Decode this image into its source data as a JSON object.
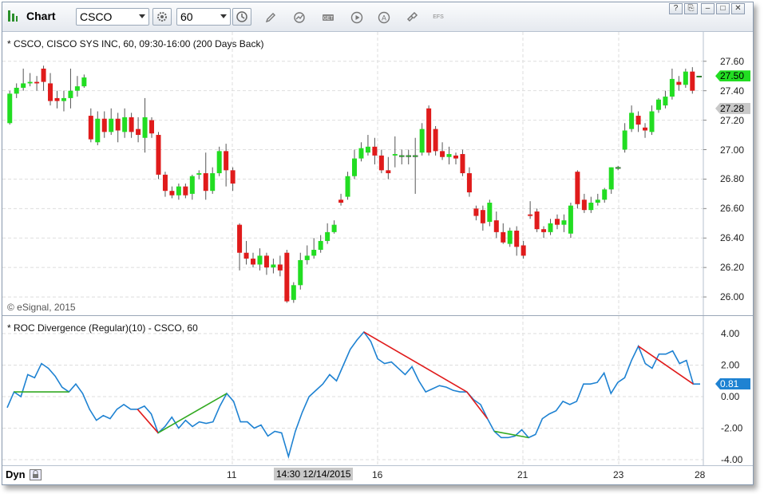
{
  "window": {
    "title": "Chart",
    "controls": [
      "?",
      "⎘",
      "–",
      "□",
      "✕"
    ]
  },
  "toolbar": {
    "symbol": "CSCO",
    "interval": "60",
    "tools": [
      "pencil-icon",
      "cycle-icon",
      "chart-type-icon",
      "play-icon",
      "a-icon",
      "link-icon"
    ],
    "efs_label": "EFS"
  },
  "price_pane": {
    "title": "* CSCO, CISCO SYS INC, 60, 09:30-16:00 (200 Days Back)",
    "watermark": "© eSignal, 2015",
    "y_ticks": [
      "27.60",
      "27.40",
      "27.20",
      "27.00",
      "26.80",
      "26.60",
      "26.40",
      "26.20",
      "26.00"
    ],
    "last_price": "27.50",
    "last_price_color": "#22dd22",
    "ref_price": "27.28",
    "ref_price_color": "#c8c8c8"
  },
  "roc_pane": {
    "title": "* ROC Divergence (Regular)(10) - CSCO, 60",
    "y_ticks": [
      "4.00",
      "2.00",
      "0.00",
      "-2.00",
      "-4.00"
    ],
    "last_value": "0.81",
    "last_value_color": "#1e82d2"
  },
  "x_axis": {
    "mode": "Dyn",
    "labels": [
      "11",
      "16",
      "21",
      "23",
      "28"
    ],
    "cursor_label": "14:30 12/14/2015"
  },
  "colors": {
    "up": "#22dd22",
    "down": "#e01b1b",
    "roc_line": "#1e82d2",
    "bull_div": "#33aa22",
    "bear_div": "#e01b1b"
  },
  "chart_data": [
    {
      "type": "candlestick",
      "title": "* CSCO, CISCO SYS INC, 60, 09:30-16:00 (200 Days Back)",
      "ylim": [
        25.93,
        27.68
      ],
      "candles": [
        [
          27.18,
          27.38,
          27.17,
          27.4
        ],
        [
          27.38,
          27.42,
          27.35,
          27.45
        ],
        [
          27.42,
          27.45,
          27.4,
          27.55
        ],
        [
          27.45,
          27.46,
          27.43,
          27.52
        ],
        [
          27.46,
          27.45,
          27.4,
          27.5
        ],
        [
          27.55,
          27.46,
          27.4,
          27.57
        ],
        [
          27.45,
          27.33,
          27.3,
          27.52
        ],
        [
          27.35,
          27.33,
          27.28,
          27.4
        ],
        [
          27.33,
          27.35,
          27.26,
          27.4
        ],
        [
          27.35,
          27.4,
          27.28,
          27.55
        ],
        [
          27.4,
          27.43,
          27.36,
          27.5
        ],
        [
          27.43,
          27.49,
          27.42,
          27.51
        ],
        [
          27.23,
          27.07,
          27.05,
          27.28
        ],
        [
          27.05,
          27.21,
          27.03,
          27.26
        ],
        [
          27.21,
          27.12,
          27.08,
          27.26
        ],
        [
          27.12,
          27.21,
          27.1,
          27.28
        ],
        [
          27.21,
          27.13,
          27.05,
          27.25
        ],
        [
          27.12,
          27.22,
          27.08,
          27.28
        ],
        [
          27.22,
          27.12,
          27.08,
          27.25
        ],
        [
          27.14,
          27.1,
          27.05,
          27.22
        ],
        [
          27.08,
          27.22,
          26.98,
          27.35
        ],
        [
          27.2,
          27.11,
          27.08,
          27.22
        ],
        [
          27.1,
          26.83,
          26.8,
          27.12
        ],
        [
          26.83,
          26.72,
          26.68,
          26.85
        ],
        [
          26.72,
          26.69,
          26.67,
          26.75
        ],
        [
          26.69,
          26.75,
          26.66,
          26.77
        ],
        [
          26.75,
          26.69,
          26.67,
          26.77
        ],
        [
          26.7,
          26.82,
          26.66,
          26.83
        ],
        [
          26.83,
          26.84,
          26.8,
          26.86
        ],
        [
          26.84,
          26.72,
          26.66,
          26.98
        ],
        [
          26.72,
          26.84,
          26.7,
          26.88
        ],
        [
          26.84,
          26.99,
          26.82,
          27.02
        ],
        [
          26.99,
          26.86,
          26.75,
          27.04
        ],
        [
          26.86,
          26.77,
          26.72,
          26.88
        ],
        [
          26.49,
          26.3,
          26.18,
          26.5
        ],
        [
          26.3,
          26.26,
          26.22,
          26.38
        ],
        [
          26.26,
          26.22,
          26.2,
          26.3
        ],
        [
          26.22,
          26.28,
          26.18,
          26.33
        ],
        [
          26.28,
          26.2,
          26.15,
          26.3
        ],
        [
          26.2,
          26.22,
          26.16,
          26.26
        ],
        [
          26.22,
          26.18,
          26.14,
          26.28
        ],
        [
          26.3,
          25.97,
          25.96,
          26.32
        ],
        [
          25.98,
          26.08,
          25.96,
          26.1
        ],
        [
          26.08,
          26.25,
          26.05,
          26.3
        ],
        [
          26.25,
          26.28,
          26.22,
          26.35
        ],
        [
          26.28,
          26.32,
          26.26,
          26.4
        ],
        [
          26.32,
          26.38,
          26.3,
          26.42
        ],
        [
          26.38,
          26.44,
          26.36,
          26.5
        ],
        [
          26.44,
          26.49,
          26.43,
          26.52
        ],
        [
          26.66,
          26.64,
          26.62,
          26.7
        ],
        [
          26.68,
          26.82,
          26.66,
          26.85
        ],
        [
          26.82,
          26.94,
          26.8,
          27.0
        ],
        [
          26.94,
          27.01,
          26.92,
          27.05
        ],
        [
          26.98,
          27.02,
          26.96,
          27.1
        ],
        [
          27.02,
          26.96,
          26.9,
          27.08
        ],
        [
          26.96,
          26.86,
          26.84,
          27.0
        ],
        [
          26.86,
          26.84,
          26.8,
          26.95
        ],
        [
          26.96,
          26.97,
          26.88,
          27.09
        ],
        [
          26.96,
          26.96,
          26.9,
          27.0
        ],
        [
          26.96,
          26.96,
          26.9,
          27.0
        ],
        [
          26.96,
          26.96,
          26.7,
          27.08
        ],
        [
          26.98,
          27.14,
          26.96,
          27.18
        ],
        [
          27.28,
          26.98,
          26.96,
          27.3
        ],
        [
          27.14,
          26.99,
          26.96,
          27.16
        ],
        [
          26.99,
          26.95,
          26.93,
          27.05
        ],
        [
          26.95,
          26.97,
          26.9,
          27.02
        ],
        [
          26.96,
          26.94,
          26.9,
          26.98
        ],
        [
          26.97,
          26.84,
          26.82,
          27.0
        ],
        [
          26.84,
          26.71,
          26.68,
          26.88
        ],
        [
          26.6,
          26.55,
          26.52,
          26.62
        ],
        [
          26.59,
          26.5,
          26.45,
          26.62
        ],
        [
          26.51,
          26.64,
          26.48,
          26.66
        ],
        [
          26.52,
          26.44,
          26.4,
          26.58
        ],
        [
          26.44,
          26.37,
          26.36,
          26.5
        ],
        [
          26.36,
          26.45,
          26.34,
          26.47
        ],
        [
          26.45,
          26.34,
          26.28,
          26.48
        ],
        [
          26.35,
          26.28,
          26.26,
          26.38
        ],
        [
          26.56,
          26.55,
          26.53,
          26.65
        ],
        [
          26.58,
          26.46,
          26.44,
          26.6
        ],
        [
          26.46,
          26.44,
          26.4,
          26.48
        ],
        [
          26.44,
          26.5,
          26.42,
          26.53
        ],
        [
          26.53,
          26.49,
          26.46,
          26.56
        ],
        [
          26.49,
          26.52,
          26.44,
          26.56
        ],
        [
          26.43,
          26.62,
          26.4,
          26.64
        ],
        [
          26.85,
          26.63,
          26.6,
          26.86
        ],
        [
          26.66,
          26.59,
          26.57,
          26.7
        ],
        [
          26.59,
          26.64,
          26.57,
          26.68
        ],
        [
          26.64,
          26.66,
          26.62,
          26.7
        ],
        [
          26.66,
          26.73,
          26.64,
          26.74
        ],
        [
          26.73,
          26.88,
          26.7,
          26.88
        ],
        [
          26.88,
          26.88,
          26.86,
          26.89
        ],
        [
          27.0,
          27.13,
          26.98,
          27.18
        ],
        [
          27.14,
          27.25,
          27.12,
          27.3
        ],
        [
          27.23,
          27.17,
          27.12,
          27.26
        ],
        [
          27.15,
          27.13,
          27.08,
          27.18
        ],
        [
          27.12,
          27.26,
          27.1,
          27.3
        ],
        [
          27.27,
          27.34,
          27.25,
          27.35
        ],
        [
          27.3,
          27.36,
          27.28,
          27.4
        ],
        [
          27.36,
          27.48,
          27.34,
          27.55
        ],
        [
          27.46,
          27.44,
          27.4,
          27.5
        ],
        [
          27.44,
          27.53,
          27.42,
          27.55
        ],
        [
          27.53,
          27.4,
          27.38,
          27.56
        ],
        [
          27.5,
          27.5,
          27.49,
          27.5
        ]
      ]
    },
    {
      "type": "line",
      "title": "* ROC Divergence (Regular)(10) - CSCO, 60",
      "ylim": [
        -4.0,
        4.0
      ],
      "values": [
        -0.7,
        0.3,
        0.0,
        1.4,
        1.2,
        2.1,
        1.8,
        1.3,
        0.6,
        0.3,
        0.8,
        0.2,
        -0.8,
        -1.5,
        -1.2,
        -1.4,
        -0.8,
        -0.5,
        -0.8,
        -0.8,
        -0.6,
        -1.1,
        -2.3,
        -1.9,
        -1.3,
        -2.0,
        -1.5,
        -1.9,
        -1.6,
        -1.7,
        -1.6,
        -0.6,
        0.2,
        -0.3,
        -1.6,
        -1.6,
        -2.0,
        -1.8,
        -2.5,
        -2.2,
        -2.3,
        -3.8,
        -2.2,
        -1.0,
        0.0,
        0.4,
        0.8,
        1.4,
        1.0,
        2.0,
        3.0,
        3.6,
        4.1,
        3.5,
        2.4,
        2.1,
        2.2,
        1.8,
        1.4,
        1.9,
        1.0,
        0.3,
        0.5,
        0.7,
        0.6,
        0.4,
        0.3,
        0.3,
        -0.2,
        -0.5,
        -1.4,
        -2.2,
        -2.6,
        -2.6,
        -2.5,
        -2.1,
        -2.6,
        -2.4,
        -1.4,
        -1.1,
        -0.9,
        -0.3,
        -0.5,
        -0.3,
        0.8,
        0.8,
        0.9,
        1.5,
        0.2,
        0.9,
        1.2,
        2.3,
        3.2,
        2.1,
        1.8,
        2.7,
        2.7,
        2.9,
        2.1,
        2.3,
        0.8,
        0.8
      ],
      "divergences": [
        {
          "kind": "bullish",
          "from": 1,
          "to": 9
        },
        {
          "kind": "bearish",
          "from": 19,
          "to": 22
        },
        {
          "kind": "bullish",
          "from": 22,
          "to": 32
        },
        {
          "kind": "bearish",
          "from": 52,
          "to": 67
        },
        {
          "kind": "bearish",
          "from": 67,
          "to": 70
        },
        {
          "kind": "bullish",
          "from": 71,
          "to": 76
        },
        {
          "kind": "bearish",
          "from": 92,
          "to": 100
        }
      ]
    }
  ]
}
